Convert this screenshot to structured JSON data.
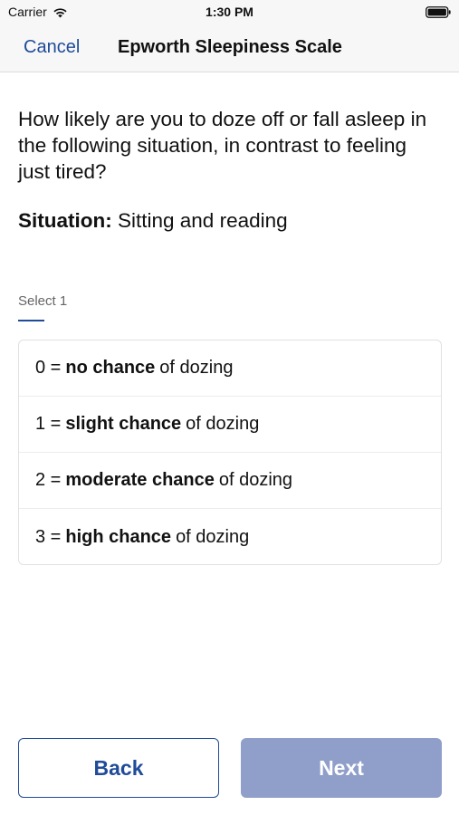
{
  "status_bar": {
    "carrier": "Carrier",
    "time": "1:30 PM",
    "icons": [
      "wifi-icon",
      "battery-icon"
    ]
  },
  "nav": {
    "cancel_label": "Cancel",
    "title": "Epworth Sleepiness Scale"
  },
  "question": {
    "text": "How likely are you to doze off or fall asleep in the following situation, in contrast to feeling just tired?",
    "situation_label": "Situation:",
    "situation_value": "Sitting and reading"
  },
  "select_hint": "Select 1",
  "options": [
    {
      "prefix": "0 =",
      "bold": "no chance",
      "suffix": "of dozing"
    },
    {
      "prefix": "1 =",
      "bold": "slight chance",
      "suffix": "of dozing"
    },
    {
      "prefix": "2 =",
      "bold": "moderate chance",
      "suffix": "of dozing"
    },
    {
      "prefix": "3 =",
      "bold": "high chance",
      "suffix": "of dozing"
    }
  ],
  "buttons": {
    "back_label": "Back",
    "next_label": "Next"
  },
  "colors": {
    "accent": "#1f4b99",
    "next_disabled": "#8f9fc9",
    "bar_bg": "#f7f7f7"
  }
}
